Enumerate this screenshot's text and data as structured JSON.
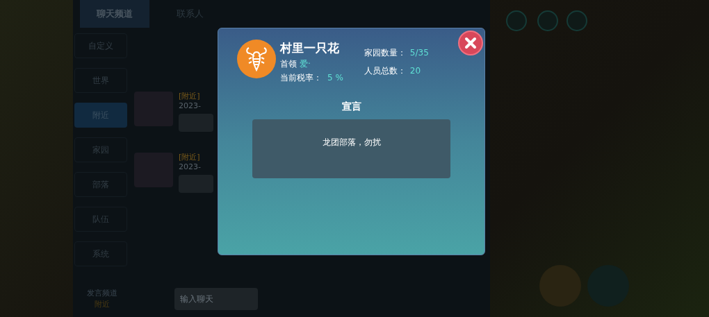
{
  "chat_panel": {
    "tabs": [
      {
        "label": "聊天频道",
        "selected": true
      },
      {
        "label": "联系人",
        "selected": false
      }
    ],
    "channels": [
      {
        "label": "自定义",
        "selected": false
      },
      {
        "label": "世界",
        "selected": false
      },
      {
        "label": "附近",
        "selected": true
      },
      {
        "label": "家园",
        "selected": false
      },
      {
        "label": "部落",
        "selected": false
      },
      {
        "label": "队伍",
        "selected": false
      },
      {
        "label": "系统",
        "selected": false
      }
    ],
    "messages": [
      {
        "channel": "[附近]",
        "time": "2023-"
      },
      {
        "channel": "[附近]",
        "time": "2023-"
      }
    ],
    "send_channel": {
      "label": "发言频道",
      "value": "附近"
    },
    "input": {
      "placeholder": "输入聊天"
    }
  },
  "tribe_dialog": {
    "name": "村里一只花",
    "leader_label": "首领",
    "leader": "爱·",
    "tax_label": "当前税率：",
    "tax": "5 %",
    "homes_label": "家园数量：",
    "homes": "5/35",
    "members_label": "人员总数：",
    "members": "20",
    "declaration_title": "宣言",
    "declaration": "龙团部落，勿扰"
  }
}
